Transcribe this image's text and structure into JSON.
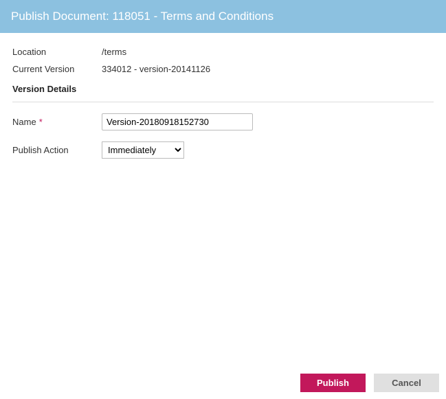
{
  "header": {
    "title": "Publish Document: 118051 - Terms and Conditions"
  },
  "info": {
    "location_label": "Location",
    "location_value": "/terms",
    "current_version_label": "Current Version",
    "current_version_value": "334012 - version-20141126"
  },
  "section": {
    "version_details": "Version Details"
  },
  "form": {
    "name_label": "Name",
    "name_value": "Version-20180918152730",
    "publish_action_label": "Publish Action",
    "publish_action_selected": "Immediately"
  },
  "footer": {
    "publish_label": "Publish",
    "cancel_label": "Cancel"
  }
}
